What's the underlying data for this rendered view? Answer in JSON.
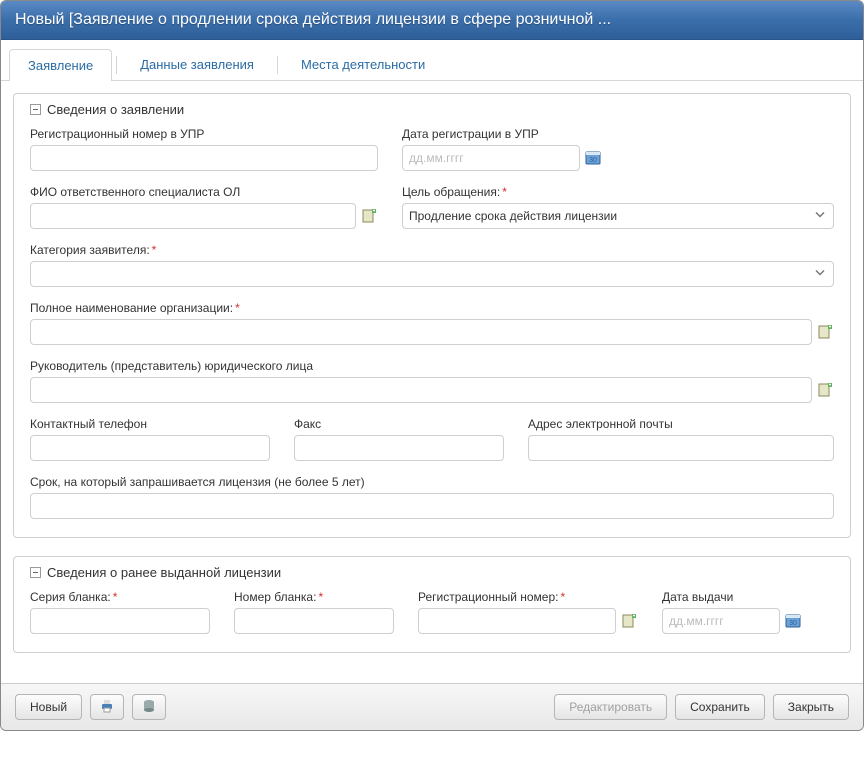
{
  "window": {
    "title": "Новый [Заявление о продлении срока действия лицензии в сфере розничной ..."
  },
  "tabs": [
    {
      "label": "Заявление",
      "active": true
    },
    {
      "label": "Данные заявления",
      "active": false
    },
    {
      "label": "Места деятельности",
      "active": false
    }
  ],
  "section_app": {
    "title": "Сведения о заявлении",
    "reg_number_label": "Регистрационный номер в УПР",
    "reg_number_value": "",
    "reg_date_label": "Дата регистрации в УПР",
    "reg_date_placeholder": "дд.мм.гггг",
    "reg_date_value": "",
    "responsible_label": "ФИО ответственного специалиста ОЛ",
    "responsible_value": "",
    "purpose_label": "Цель обращения:",
    "purpose_value": "Продление срока действия лицензии",
    "category_label": "Категория заявителя:",
    "category_value": "",
    "org_full_name_label": "Полное наименование организации:",
    "org_full_name_value": "",
    "head_label": "Руководитель (представитель) юридического лица",
    "head_value": "",
    "phone_label": "Контактный телефон",
    "phone_value": "",
    "fax_label": "Факс",
    "fax_value": "",
    "email_label": "Адрес электронной почты",
    "email_value": "",
    "term_label": "Срок, на который запрашивается лицензия (не более 5 лет)",
    "term_value": ""
  },
  "section_license": {
    "title": "Сведения о ранее выданной лицензии",
    "series_label": "Серия бланка:",
    "series_value": "",
    "blank_number_label": "Номер бланка:",
    "blank_number_value": "",
    "reg_number_label": "Регистрационный номер:",
    "reg_number_value": "",
    "issue_date_label": "Дата выдачи",
    "issue_date_placeholder": "дд.мм.гггг",
    "issue_date_value": ""
  },
  "footer": {
    "new_label": "Новый",
    "edit_label": "Редактировать",
    "save_label": "Сохранить",
    "close_label": "Закрыть"
  }
}
